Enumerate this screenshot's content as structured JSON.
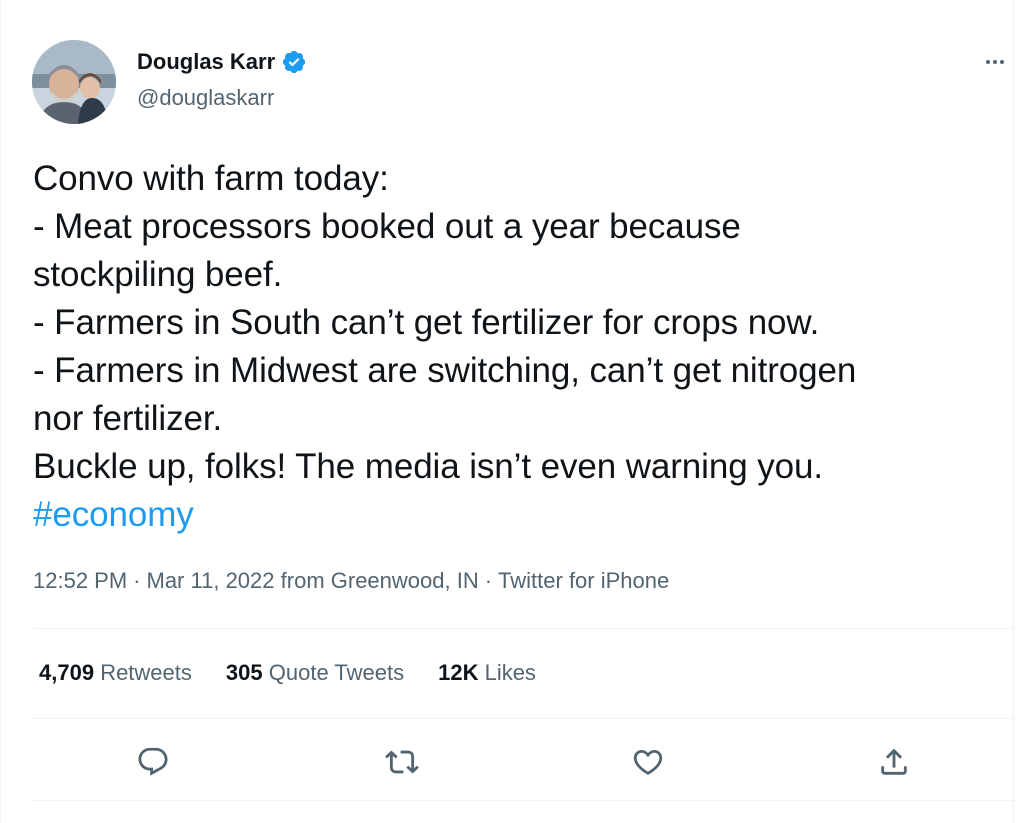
{
  "author": {
    "display_name": "Douglas Karr",
    "handle": "@douglaskarr",
    "verified": true,
    "verified_color": "#1d9bf0"
  },
  "tweet": {
    "lines": [
      "Convo with farm today:",
      "- Meat processors booked out a year because",
      "stockpiling beef.",
      "- Farmers in South can’t get fertilizer for crops now.",
      "- Farmers in Midwest are switching, can’t get nitrogen",
      "nor fertilizer.",
      "Buckle up, folks! The media isn’t even warning you."
    ],
    "hashtag": "#economy",
    "hashtag_color": "#1d9bf0"
  },
  "meta": {
    "time": "12:52 PM",
    "date": "Mar 11, 2022",
    "location": "from Greenwood, IN",
    "source": "Twitter for iPhone",
    "separator": "·"
  },
  "stats": {
    "retweets_count": "4,709",
    "retweets_label": "Retweets",
    "quotes_count": "305",
    "quotes_label": "Quote Tweets",
    "likes_count": "12K",
    "likes_label": "Likes"
  },
  "actions": [
    {
      "icon": "reply-icon"
    },
    {
      "icon": "retweet-icon"
    },
    {
      "icon": "like-icon"
    },
    {
      "icon": "share-icon"
    }
  ],
  "colors": {
    "text": "#0f1419",
    "secondary": "#536471",
    "divider": "#eff3f4"
  }
}
